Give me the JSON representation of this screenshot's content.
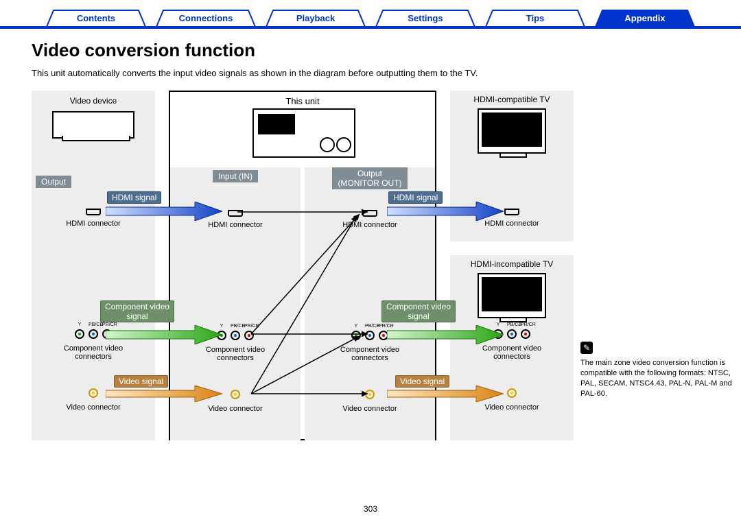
{
  "tabs": {
    "contents": "Contents",
    "connections": "Connections",
    "playback": "Playback",
    "settings": "Settings",
    "tips": "Tips",
    "appendix": "Appendix"
  },
  "title": "Video conversion function",
  "intro": "This unit automatically converts the input video signals as shown in the diagram before outputting them to the TV.",
  "diagram": {
    "video_device": "Video device",
    "this_unit": "This unit",
    "hdmi_tv": "HDMI-compatible TV",
    "non_hdmi_tv": "HDMI-incompatible TV",
    "output": "Output",
    "input_in": "Input (IN)",
    "output_monitor": "Output\n(MONITOR OUT)",
    "hdmi_signal": "HDMI signal",
    "component_signal": "Component video\nsignal",
    "video_signal": "Video signal",
    "hdmi_connector": "HDMI connector",
    "component_connectors": "Component video\nconnectors",
    "video_connector": "Video connector",
    "rca_y": "Y",
    "rca_pb": "PB/CB",
    "rca_pr": "PR/CR"
  },
  "note": "The main zone video conversion function is compatible with the following formats: NTSC, PAL, SECAM, NTSC4.43, PAL-N, PAL-M and PAL-60.",
  "page": "303"
}
